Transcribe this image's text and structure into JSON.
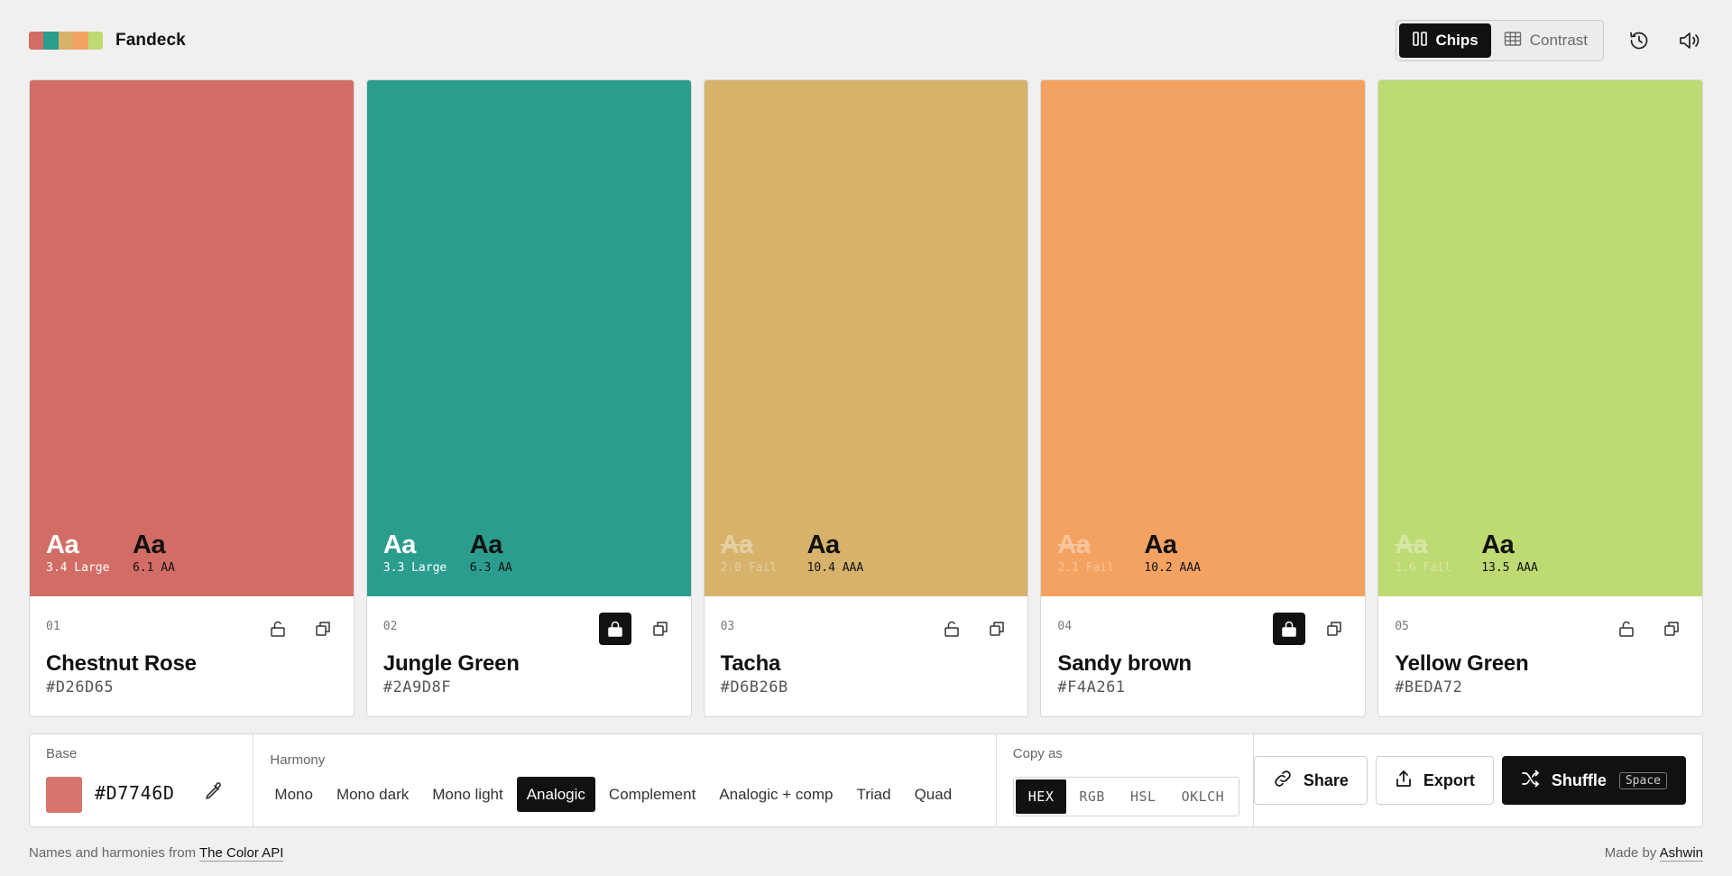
{
  "app": {
    "name": "Fandeck",
    "logo_colors": [
      "#D26D65",
      "#2A9D8F",
      "#D6B26B",
      "#F4A261",
      "#BEDA72"
    ]
  },
  "header": {
    "view_toggle": [
      {
        "label": "Chips",
        "icon": "columns-icon",
        "active": true
      },
      {
        "label": "Contrast",
        "icon": "table-icon",
        "active": false
      }
    ],
    "history_icon": "history-icon",
    "sound_icon": "speaker-icon"
  },
  "cards": [
    {
      "index": "01",
      "name": "Chestnut Rose",
      "hex": "#D26D65",
      "color": "#D26D65",
      "locked": false,
      "contrast": [
        {
          "aa": "Aa",
          "ratio": "3.4 Large",
          "tone": "white",
          "fail": false
        },
        {
          "aa": "Aa",
          "ratio": "6.1 AA",
          "tone": "black",
          "fail": false
        }
      ]
    },
    {
      "index": "02",
      "name": "Jungle Green",
      "hex": "#2A9D8F",
      "color": "#2A9D8F",
      "locked": true,
      "contrast": [
        {
          "aa": "Aa",
          "ratio": "3.3 Large",
          "tone": "white",
          "fail": false
        },
        {
          "aa": "Aa",
          "ratio": "6.3 AA",
          "tone": "black",
          "fail": false
        }
      ]
    },
    {
      "index": "03",
      "name": "Tacha",
      "hex": "#D6B26B",
      "color": "#D6B26B",
      "locked": false,
      "contrast": [
        {
          "aa": "Aa",
          "ratio": "2.0 Fail",
          "tone": "white",
          "fail": true
        },
        {
          "aa": "Aa",
          "ratio": "10.4 AAA",
          "tone": "black",
          "fail": false
        }
      ]
    },
    {
      "index": "04",
      "name": "Sandy brown",
      "hex": "#F4A261",
      "color": "#F4A261",
      "locked": true,
      "contrast": [
        {
          "aa": "Aa",
          "ratio": "2.1 Fail",
          "tone": "white",
          "fail": true
        },
        {
          "aa": "Aa",
          "ratio": "10.2 AAA",
          "tone": "black",
          "fail": false
        }
      ]
    },
    {
      "index": "05",
      "name": "Yellow Green",
      "hex": "#BEDA72",
      "color": "#BEDA72",
      "locked": false,
      "contrast": [
        {
          "aa": "Aa",
          "ratio": "1.6 Fail",
          "tone": "white",
          "fail": true
        },
        {
          "aa": "Aa",
          "ratio": "13.5 AAA",
          "tone": "black",
          "fail": false
        }
      ]
    }
  ],
  "toolbar": {
    "base": {
      "label": "Base",
      "hex": "#D7746D",
      "color": "#D7746D"
    },
    "harmony": {
      "label": "Harmony",
      "options": [
        "Mono",
        "Mono dark",
        "Mono light",
        "Analogic",
        "Complement",
        "Analogic + comp",
        "Triad",
        "Quad"
      ],
      "selected": "Analogic"
    },
    "copy_as": {
      "label": "Copy as",
      "options": [
        "HEX",
        "RGB",
        "HSL",
        "OKLCH"
      ],
      "selected": "HEX"
    },
    "share_label": "Share",
    "export_label": "Export",
    "shuffle_label": "Shuffle",
    "shuffle_shortcut": "Space"
  },
  "footer": {
    "left_prefix": "Names and harmonies from",
    "left_link": "The Color API",
    "right_prefix": "Made by",
    "right_link": "Ashwin"
  }
}
